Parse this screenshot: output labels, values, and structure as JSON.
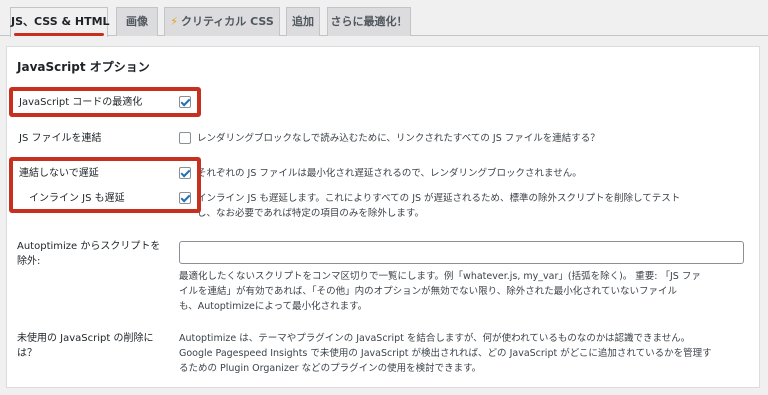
{
  "tabs": [
    {
      "label": "JS、CSS & HTML",
      "active": true
    },
    {
      "label": "画像"
    },
    {
      "label": "クリティカル CSS",
      "icon": "lightning-icon"
    },
    {
      "label": "追加"
    },
    {
      "label": "さらに最適化！"
    }
  ],
  "section_title": "JavaScript オプション",
  "options": {
    "optimize": {
      "label": "JavaScript コードの最適化",
      "checked": true
    },
    "aggregate": {
      "label": "JS ファイルを連結",
      "checked": false,
      "desc": "レンダリングブロックなしで読み込むために、リンクされたすべての JS ファイルを連結する？"
    },
    "defer": {
      "label": "連結しないで遅延",
      "checked": true,
      "desc": "それぞれの JS ファイルは最小化され遅延されるので、レンダリングブロックされません。"
    },
    "defer_inline": {
      "label": "インライン JS も遅延",
      "checked": true,
      "desc_line1": "インライン JS も遅延します。これによりすべての JS が遅延されるため、標準の除外スクリプトを削除してテスト",
      "desc_line2": "し、なお必要であれば特定の項目のみを除外します。"
    },
    "exclude": {
      "label_line1": "Autoptimize からスクリプトを",
      "label_line2": "除外:",
      "value": "",
      "desc_line1": "最適化したくないスクリプトをコンマ区切りで一覧にします。例「whatever.js, my_var」(括弧を除く)。 重要: 「JS ファ",
      "desc_line2": "イルを連結」が有効であれば、「その他」内のオプションが無効でない限り、除外された最小化されていないファイル",
      "desc_line3": "も、Autoptimizeによって最小化されます。"
    },
    "unused": {
      "label_line1": "未使用の JavaScript の削除に",
      "label_line2": "は？",
      "desc_line1": "Autoptimize は、テーマやプラグインの JavaScript を結合しますが、何が使われているものなのかは認識できません。",
      "desc_line2": "Google Pagespeed Insights で未使用の JavaScript が検出されれば、どの JavaScript がどこに追加されているかを管理す",
      "desc_line3": "るための Plugin Organizer などのプラグインの使用を検討できます。"
    }
  },
  "colors": {
    "highlight": "#c7301e",
    "check": "#2271b1",
    "bolt": "#dba617"
  }
}
